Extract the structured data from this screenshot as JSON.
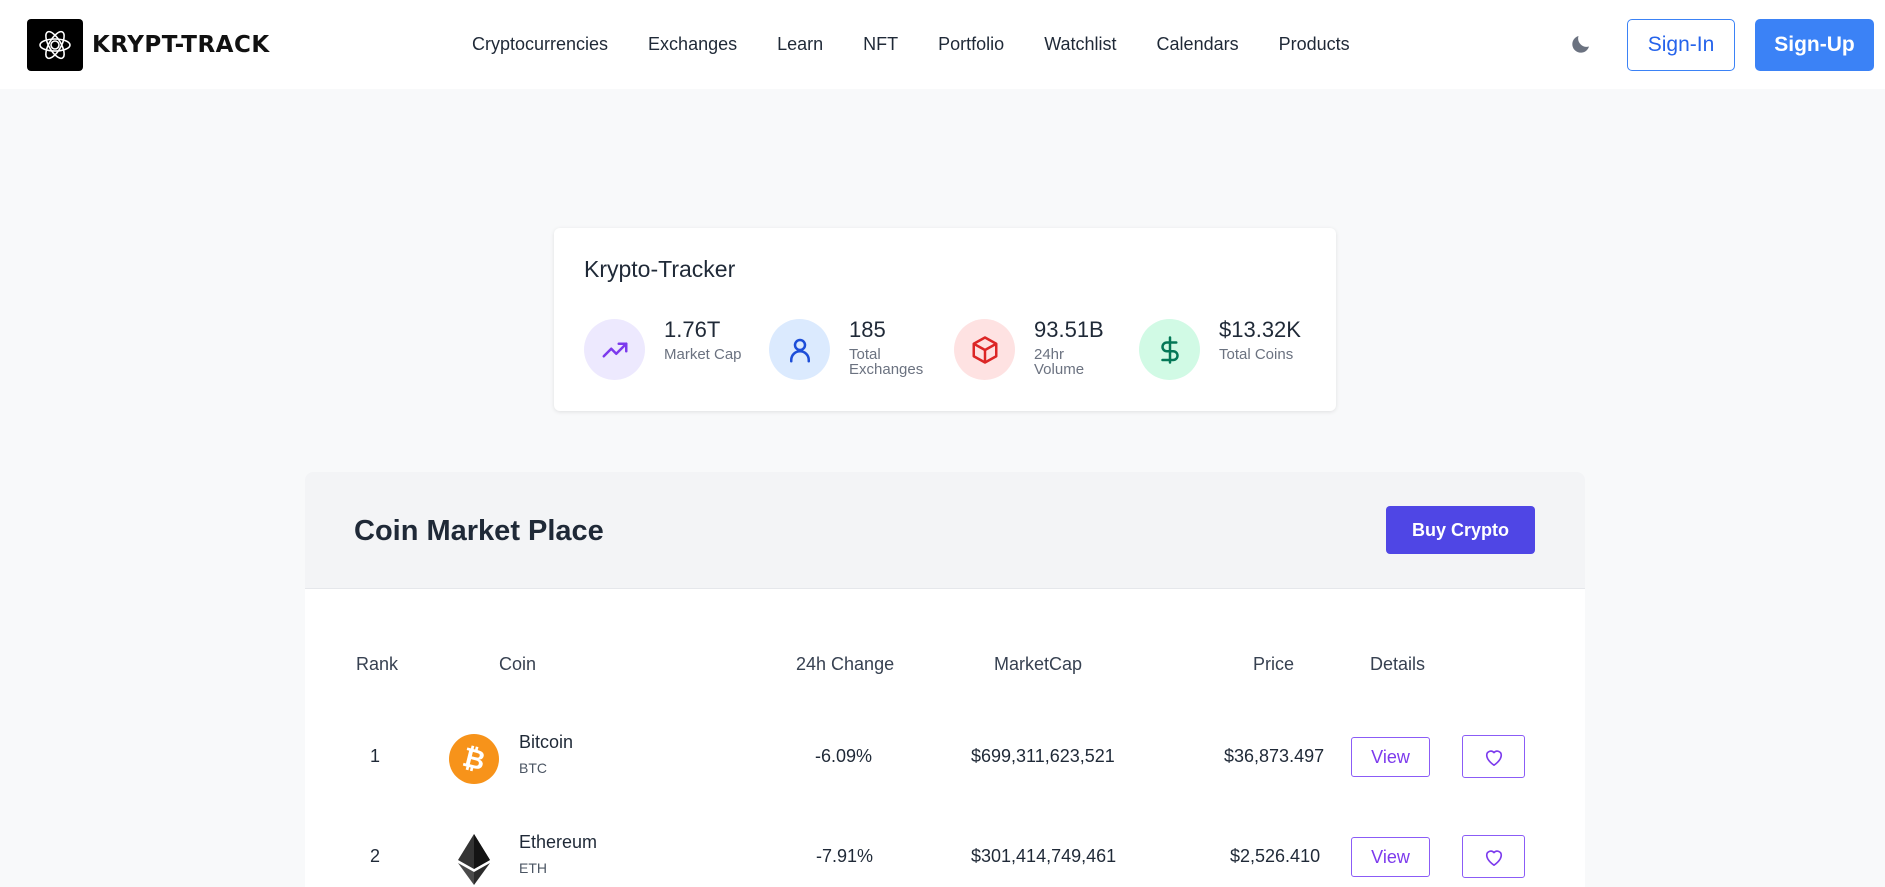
{
  "brand": {
    "name": "KRYPT-TRACK"
  },
  "nav": {
    "items": [
      {
        "label": "Cryptocurrencies"
      },
      {
        "label": "Exchanges"
      },
      {
        "label": "Learn"
      },
      {
        "label": "NFT"
      },
      {
        "label": "Portfolio"
      },
      {
        "label": "Watchlist"
      },
      {
        "label": "Calendars"
      },
      {
        "label": "Products"
      }
    ]
  },
  "header": {
    "theme_icon": "moon-icon",
    "signin_label": "Sign-In",
    "signup_label": "Sign-Up"
  },
  "stats": {
    "title": "Krypto-Tracker",
    "items": [
      {
        "value": "1.76T",
        "label": "Market Cap",
        "icon": "trending-up-icon",
        "color": "#7c3aed",
        "bg": "#ede9fe"
      },
      {
        "value": "185",
        "label": "Total Exchanges",
        "icon": "user-icon",
        "color": "#1d4ed8",
        "bg": "#dbeafe"
      },
      {
        "value": "93.51B",
        "label": "24hr Volume",
        "icon": "cube-icon",
        "color": "#dc2626",
        "bg": "#fee2e2"
      },
      {
        "value": "$13.32K",
        "label": "Total Coins",
        "icon": "dollar-icon",
        "color": "#047857",
        "bg": "#d1fae5"
      }
    ]
  },
  "market": {
    "title": "Coin Market Place",
    "buy_label": "Buy Crypto",
    "columns": [
      "Rank",
      "Coin",
      "24h Change",
      "MarketCap",
      "Price",
      "Details"
    ],
    "rows": [
      {
        "rank": "1",
        "name": "Bitcoin",
        "symbol": "BTC",
        "change": "-6.09%",
        "market_cap": "$699,311,623,521",
        "price": "$36,873.497",
        "view_label": "View",
        "logo": "bitcoin-logo"
      },
      {
        "rank": "2",
        "name": "Ethereum",
        "symbol": "ETH",
        "change": "-7.91%",
        "market_cap": "$301,414,749,461",
        "price": "$2,526.410",
        "view_label": "View",
        "logo": "ethereum-logo"
      }
    ]
  },
  "colors": {
    "primary": "#3b82f6",
    "accent": "#4f46e5",
    "outline_accent": "#8b5cf6",
    "bitcoin": "#f7931a"
  }
}
